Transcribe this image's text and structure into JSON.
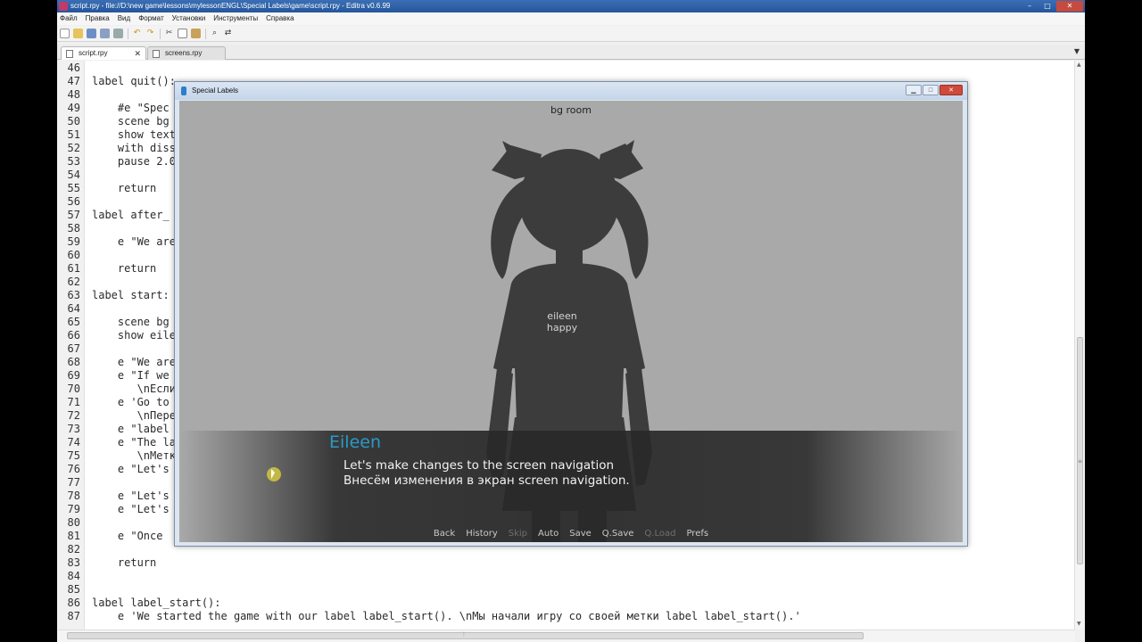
{
  "editor_window": {
    "title": "script.rpy - file://D:\\new game\\lessons\\mylessonENGL\\Special Labels\\game\\script.rpy - Editra v0.6.99",
    "controls": {
      "minimize": "–",
      "maximize": "□",
      "close": "✕"
    }
  },
  "menu": [
    "Файл",
    "Правка",
    "Вид",
    "Формат",
    "Установки",
    "Инструменты",
    "Справка"
  ],
  "toolbar_icons": [
    "new-icon",
    "open-icon",
    "save-icon",
    "save-as-icon",
    "print-icon",
    "undo-icon",
    "redo-icon",
    "cut-icon",
    "copy-icon",
    "paste-icon",
    "find-icon",
    "replace-icon"
  ],
  "tabs": [
    {
      "label": "script.rpy",
      "close": "✕",
      "active": true
    },
    {
      "label": "screens.rpy",
      "active": false
    }
  ],
  "tab_dropdown": "▼",
  "code_lines": [
    {
      "num": "46",
      "text": ""
    },
    {
      "num": "47",
      "text": "label quit():"
    },
    {
      "num": "48",
      "text": ""
    },
    {
      "num": "49",
      "text": "    #e \"Spec"
    },
    {
      "num": "50",
      "text": "    scene bg"
    },
    {
      "num": "51",
      "text": "    show text"
    },
    {
      "num": "52",
      "text": "    with diss"
    },
    {
      "num": "53",
      "text": "    pause 2.0"
    },
    {
      "num": "54",
      "text": ""
    },
    {
      "num": "55",
      "text": "    return"
    },
    {
      "num": "56",
      "text": ""
    },
    {
      "num": "57",
      "text": "label after_"
    },
    {
      "num": "58",
      "text": ""
    },
    {
      "num": "59",
      "text": "    e \"We are"
    },
    {
      "num": "60",
      "text": ""
    },
    {
      "num": "61",
      "text": "    return"
    },
    {
      "num": "62",
      "text": ""
    },
    {
      "num": "63",
      "text": "label start:"
    },
    {
      "num": "64",
      "text": ""
    },
    {
      "num": "65",
      "text": "    scene bg"
    },
    {
      "num": "66",
      "text": "    show eile"
    },
    {
      "num": "67",
      "text": ""
    },
    {
      "num": "68",
      "text": "    e \"We are"
    },
    {
      "num": "69",
      "text": "    e \"If we"
    },
    {
      "num": "70",
      "text": "       \\nЕсли"
    },
    {
      "num": "71",
      "text": "    e 'Go to"
    },
    {
      "num": "72",
      "text": "       \\nПере"
    },
    {
      "num": "73",
      "text": "    e \"label"
    },
    {
      "num": "74",
      "text": "    e \"The la"
    },
    {
      "num": "75",
      "text": "       \\nМетк"
    },
    {
      "num": "76",
      "text": "    e \"Let's"
    },
    {
      "num": "77",
      "text": ""
    },
    {
      "num": "78",
      "text": "    e \"Let's"
    },
    {
      "num": "79",
      "text": "    e \"Let's"
    },
    {
      "num": "80",
      "text": ""
    },
    {
      "num": "81",
      "text": "    e \"Once"
    },
    {
      "num": "82",
      "text": ""
    },
    {
      "num": "83",
      "text": "    return"
    },
    {
      "num": "84",
      "text": ""
    },
    {
      "num": "85",
      "text": ""
    },
    {
      "num": "86",
      "text": "label label_start():"
    },
    {
      "num": "87",
      "text": "    e 'We started the game with our label label_start(). \\nМы начали игру со своей метки label label_start().'"
    }
  ],
  "game_window": {
    "title": "Special Labels",
    "controls": {
      "minimize": "▁",
      "maximize": "□",
      "close": "✕"
    },
    "background_label": "bg room",
    "sprite_label_line1": "eileen",
    "sprite_label_line2": "happy",
    "speaker": "Eileen",
    "dialogue_line1": "Let's make changes to the screen navigation",
    "dialogue_line2": "Внесём изменения в экран screen navigation.",
    "quick_menu": [
      {
        "label": "Back",
        "enabled": true
      },
      {
        "label": "History",
        "enabled": true
      },
      {
        "label": "Skip",
        "enabled": false
      },
      {
        "label": "Auto",
        "enabled": true
      },
      {
        "label": "Save",
        "enabled": true
      },
      {
        "label": "Q.Save",
        "enabled": true
      },
      {
        "label": "Q.Load",
        "enabled": false
      },
      {
        "label": "Prefs",
        "enabled": true
      }
    ],
    "speaker_color": "#2a9ac8"
  }
}
